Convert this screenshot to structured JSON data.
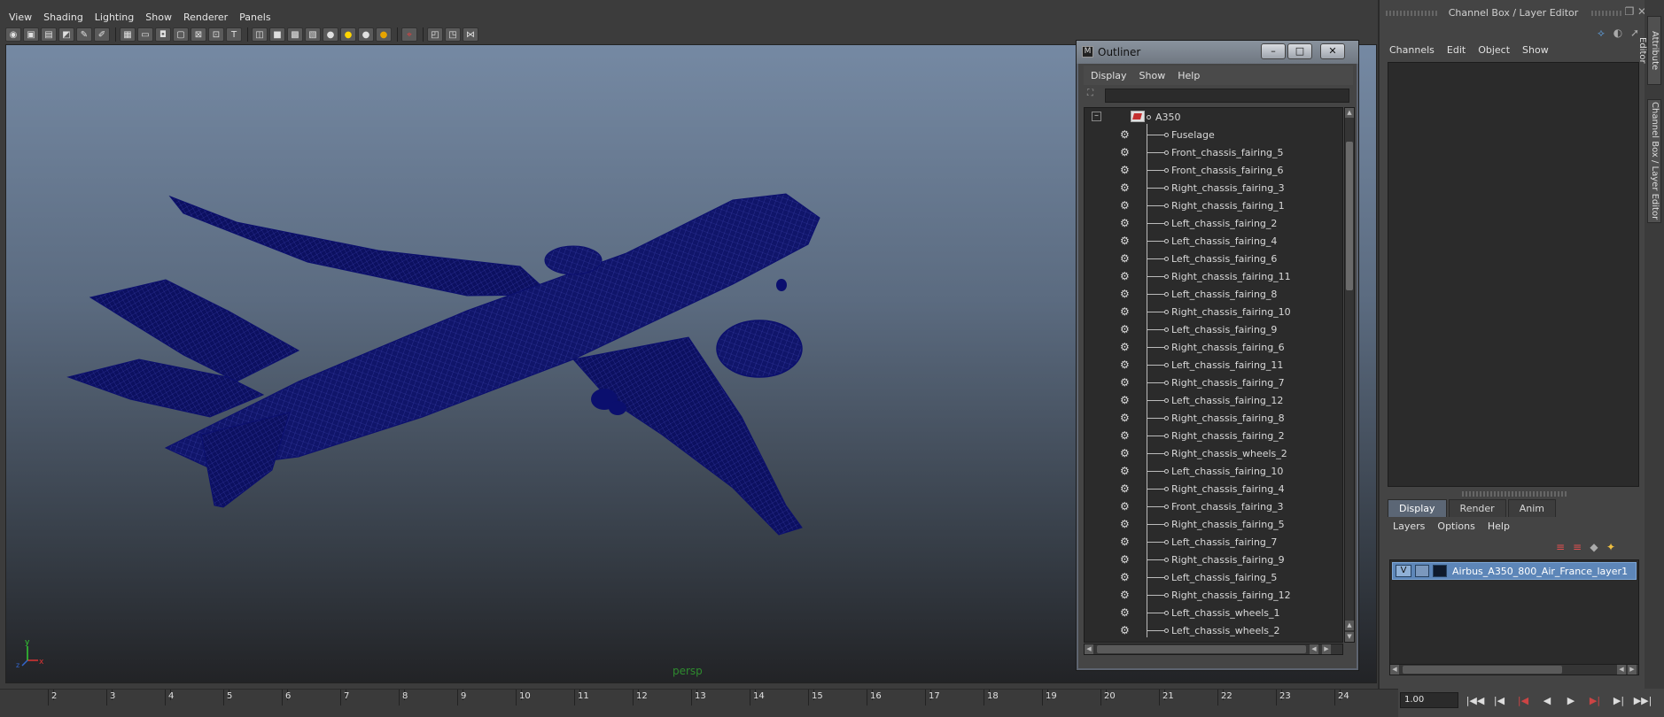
{
  "viewport": {
    "menu": [
      "View",
      "Shading",
      "Lighting",
      "Show",
      "Renderer",
      "Panels"
    ],
    "camera_label": "persp",
    "axis": {
      "x": "x",
      "y": "y",
      "z": "z"
    },
    "wire_color": "#0b0f6e"
  },
  "outliner": {
    "title": "Outliner",
    "window_buttons": {
      "minimize": "–",
      "maximize": "□",
      "close": "✕"
    },
    "menu": [
      "Display",
      "Show",
      "Help"
    ],
    "filter_placeholder": "",
    "collapse_symbol": "–",
    "root": "A350",
    "children": [
      "Fuselage",
      "Front_chassis_fairing_5",
      "Front_chassis_fairing_6",
      "Right_chassis_fairing_3",
      "Right_chassis_fairing_1",
      "Left_chassis_fairing_2",
      "Left_chassis_fairing_4",
      "Left_chassis_fairing_6",
      "Right_chassis_fairing_11",
      "Left_chassis_fairing_8",
      "Right_chassis_fairing_10",
      "Left_chassis_fairing_9",
      "Right_chassis_fairing_6",
      "Left_chassis_fairing_11",
      "Right_chassis_fairing_7",
      "Left_chassis_fairing_12",
      "Right_chassis_fairing_8",
      "Right_chassis_fairing_2",
      "Right_chassis_wheels_2",
      "Left_chassis_fairing_10",
      "Right_chassis_fairing_4",
      "Front_chassis_fairing_3",
      "Right_chassis_fairing_5",
      "Left_chassis_fairing_7",
      "Right_chassis_fairing_9",
      "Left_chassis_fairing_5",
      "Right_chassis_fairing_12",
      "Left_chassis_wheels_1",
      "Left_chassis_wheels_2"
    ]
  },
  "channel_box": {
    "title": "Channel Box / Layer Editor",
    "menu": [
      "Channels",
      "Edit",
      "Object",
      "Show"
    ],
    "layer_tabs": [
      "Display",
      "Render",
      "Anim"
    ],
    "active_tab": "Display",
    "layer_menu": [
      "Layers",
      "Options",
      "Help"
    ],
    "layers": [
      {
        "visible": "V",
        "name": "Airbus_A350_800_Air_France_layer1"
      }
    ]
  },
  "side_tabs": [
    "Attribute Editor",
    "Channel Box / Layer Editor"
  ],
  "timeline": {
    "ticks": [
      "2",
      "3",
      "4",
      "5",
      "6",
      "7",
      "8",
      "9",
      "10",
      "11",
      "12",
      "13",
      "14",
      "15",
      "16",
      "17",
      "18",
      "19",
      "20",
      "21",
      "22",
      "23",
      "24"
    ],
    "current_frame": "1.00"
  },
  "colors": {
    "accent": "#5d86b8",
    "wireframe": "#0b0f6e"
  }
}
